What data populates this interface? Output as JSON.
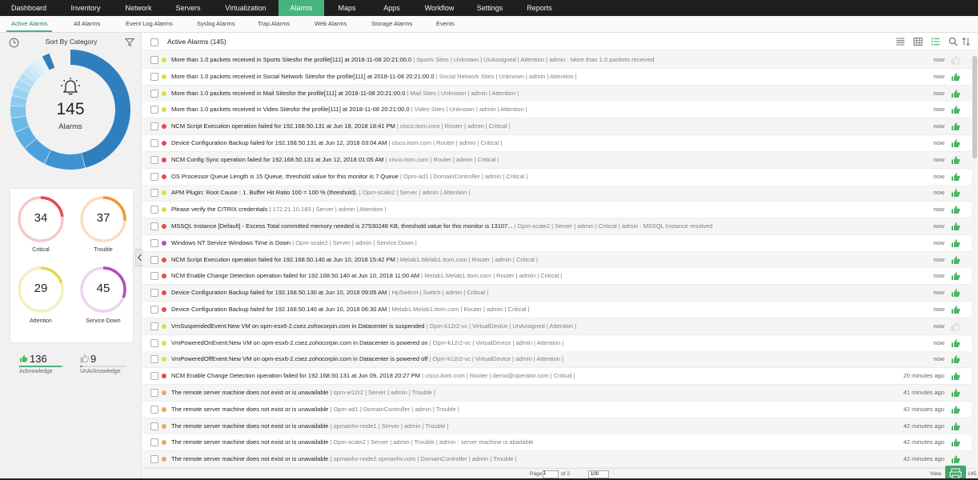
{
  "nav": {
    "items": [
      {
        "label": "Dashboard",
        "active": false
      },
      {
        "label": "Inventory",
        "active": false
      },
      {
        "label": "Network",
        "active": false
      },
      {
        "label": "Servers",
        "active": false
      },
      {
        "label": "Virtualization",
        "active": false
      },
      {
        "label": "Alarms",
        "active": true
      },
      {
        "label": "Maps",
        "active": false
      },
      {
        "label": "Apps",
        "active": false
      },
      {
        "label": "Workflow",
        "active": false
      },
      {
        "label": "Settings",
        "active": false
      },
      {
        "label": "Reports",
        "active": false
      }
    ]
  },
  "subnav": {
    "items": [
      {
        "label": "Active Alarms",
        "active": true
      },
      {
        "label": "All Alarms",
        "active": false
      },
      {
        "label": "Event Log Alarms",
        "active": false
      },
      {
        "label": "Syslog Alarms",
        "active": false
      },
      {
        "label": "Trap Alarms",
        "active": false
      },
      {
        "label": "Web Alarms",
        "active": false
      },
      {
        "label": "Storage Alarms",
        "active": false
      },
      {
        "label": "Events",
        "active": false
      }
    ]
  },
  "sidebar": {
    "sort_title": "Sort By Category",
    "donut": {
      "count": "145",
      "label": "Alarms"
    },
    "severity": [
      {
        "count": "34",
        "label": "Critical",
        "color": "#e8474f",
        "track": "#f6c7c9",
        "fraction": 0.23
      },
      {
        "count": "37",
        "label": "Trouble",
        "color": "#f29734",
        "track": "#fbdcc0",
        "fraction": 0.26
      },
      {
        "count": "29",
        "label": "Attention",
        "color": "#e3d94a",
        "track": "#f4efbf",
        "fraction": 0.2
      },
      {
        "count": "45",
        "label": "Service Down",
        "color": "#b04fb8",
        "track": "#ecd3ee",
        "fraction": 0.31
      }
    ],
    "acknowledge": {
      "count": "136",
      "label": "Acknowledge",
      "fraction": 0.94
    },
    "unacknowledge": {
      "count": "9",
      "label": "UnAcknowledge",
      "fraction": 0.06
    }
  },
  "list": {
    "title": "Active Alarms (145)",
    "rows": [
      {
        "severity": "attention",
        "main": "More than 1.0 packets received in Sports Sitesfor the profile[111] at 2018-11-08 20:21:00.0",
        "meta": " | Sports Sites | Unknown | UnAssigned | Attention | admin : More than 1.0 packets received",
        "time": "now",
        "acknowledged": false
      },
      {
        "severity": "attention",
        "main": "More than 1.0 packets received in Social Network Sitesfor the profile[111] at 2018-11-08 20:21:00.0",
        "meta": " | Social Network Sites | Unknown | admin | Attention |",
        "time": "now",
        "acknowledged": true
      },
      {
        "severity": "attention",
        "main": "More than 1.0 packets received in Mail Sitesfor the profile[111] at 2018-11-08 20:21:00.0",
        "meta": " | Mail Sites | Unknown | admin | Attention |",
        "time": "now",
        "acknowledged": true
      },
      {
        "severity": "attention",
        "main": "More than 1.0 packets received in Video Sitesfor the profile[111] at 2018-11-08 20:21:00.0",
        "meta": " | Video Sites | Unknown | admin | Attention |",
        "time": "now",
        "acknowledged": true
      },
      {
        "severity": "critical",
        "main": "NCM Script Execution operation failed for 192.168.50.131 at Jun 18, 2018 18:41 PM",
        "meta": " | cisco.itom.com | Router | admin | Critical |",
        "time": "now",
        "acknowledged": true
      },
      {
        "severity": "critical",
        "main": "Device Configuration Backup failed for 192.168.50.131 at Jun 12, 2018 03:04 AM",
        "meta": " | cisco.itom.com | Router | admin | Critical |",
        "time": "now",
        "acknowledged": true
      },
      {
        "severity": "critical",
        "main": "NCM Config Sync operation failed for 192.168.50.131 at Jun 12, 2018 01:05 AM",
        "meta": " | cisco.itom.com | Router | admin | Critical |",
        "time": "now",
        "acknowledged": true
      },
      {
        "severity": "critical",
        "main": "OS Processor Queue Length is 15 Queue, threshold value for this monitor is 7 Queue",
        "meta": " | Opm-ad1 | DomainController | admin | Critical |",
        "time": "now",
        "acknowledged": true
      },
      {
        "severity": "attention",
        "main": "APM Plugin: Root Cause : 1. Buffer Hit Ratio 100 = 100 % (threshold).",
        "meta": " | Opm-scale2 | Server | admin | Attention |",
        "time": "now",
        "acknowledged": true
      },
      {
        "severity": "attention",
        "main": "Please verify the CITRIX credentials",
        "meta": " | 172.21.10.183 | Server | admin | Attention |",
        "time": "now",
        "acknowledged": true
      },
      {
        "severity": "critical",
        "main": "MSSQL Instance [Default] - Excess Total committed memory needed is 27530248 KB, threshold value for this monitor is 13107...",
        "meta": " | Opm-scale2 | Server | admin | Critical | admin : MSSQL Instance resolved",
        "time": "now",
        "acknowledged": true
      },
      {
        "severity": "servicedown",
        "main": "Windows NT Service Windows Time is Down",
        "meta": " | Opm-scale2 | Server | admin | Service Down |",
        "time": "now",
        "acknowledged": true
      },
      {
        "severity": "critical",
        "main": "NCM Script Execution operation failed for 192.168.50.140 at Jun 10, 2018 15:42 PM",
        "meta": " | Melab1.Melab1.itom.com | Router | admin | Critical |",
        "time": "now",
        "acknowledged": true
      },
      {
        "severity": "critical",
        "main": "NCM Enable Change Detection operation failed for 192.168.50.140 at Jun 10, 2018 11:00 AM",
        "meta": " | Melab1.Melab1.itom.com | Router | admin | Critical |",
        "time": "now",
        "acknowledged": true
      },
      {
        "severity": "critical",
        "main": "Device Configuration Backup failed for 192.168.50.130 at Jun 10, 2018 09:05 AM",
        "meta": " | HpSwitcH | Switch | admin | Critical |",
        "time": "now",
        "acknowledged": true
      },
      {
        "severity": "critical",
        "main": "Device Configuration Backup failed for 192.168.50.140 at Jun 10, 2018 06:30 AM",
        "meta": " | Melab1.Melab1.itom.com | Router | admin | Critical |",
        "time": "now",
        "acknowledged": true
      },
      {
        "severity": "attention",
        "main": "VmSuspendedEvent:New VM on opm-esx6-2.csez.zohocorpin.com in Datacenter is suspended",
        "meta": " | Opm-k12r2-vc | VirtualDevice | UnAssigned | Attention |",
        "time": "now",
        "acknowledged": false
      },
      {
        "severity": "attention",
        "main": "VmPoweredOnEvent:New VM on opm-esx6-2.csez.zohocorpin.com in Datacenter is powered on",
        "meta": " | Opm-k12r2-vc | VirtualDevice | admin | Attention |",
        "time": "now",
        "acknowledged": true
      },
      {
        "severity": "attention",
        "main": "VmPoweredOffEvent:New VM on opm-esx6-2.csez.zohocorpin.com in Datacenter is powered off",
        "meta": " | Opm-k12r2-vc | VirtualDevice | admin | Attention |",
        "time": "now",
        "acknowledged": true
      },
      {
        "severity": "critical",
        "main": "NCM Enable Change Detection operation failed for 192.168.50.131 at Jun 09, 2018 20:27 PM",
        "meta": " | cisco.itom.com | Router | demo@operator.com | Critical |",
        "time": "20 minutes ago",
        "acknowledged": true
      },
      {
        "severity": "trouble",
        "main": "The remote server machine does not exist or is unavailable",
        "meta": " | opm-w12r2 | Server | admin | Trouble |",
        "time": "41 minutes ago",
        "acknowledged": true
      },
      {
        "severity": "trouble",
        "main": "The remote server machine does not exist or is unavailable",
        "meta": " | Opm-ad1 | DomainController | admin | Trouble |",
        "time": "42 minutes ago",
        "acknowledged": true
      },
      {
        "severity": "trouble",
        "main": "The remote server machine does not exist or is unavailable",
        "meta": " | opmanhv-node1 | Server | admin | Trouble |",
        "time": "42 minutes ago",
        "acknowledged": true
      },
      {
        "severity": "trouble",
        "main": "The remote server machine does not exist or is unavailable",
        "meta": " | Opm-scale2 | Server | admin | Trouble | admin : server machine is abailable",
        "time": "42 minutes ago",
        "acknowledged": true
      },
      {
        "severity": "trouble",
        "main": "The remote server machine does not exist or is unavailable",
        "meta": " | opmanhv-node2.opmanhv.com | DomainController | admin | Trouble |",
        "time": "42 minutes ago",
        "acknowledged": true
      }
    ]
  },
  "footer": {
    "page_label": "Page",
    "page_value": "1",
    "of_pages": "of 2",
    "page_size": "100",
    "view_label": "View",
    "total": "145"
  },
  "colors": {
    "accent": "#47b47d",
    "critical": "#e8474f",
    "trouble": "#f2a35a",
    "attention": "#e3d94a",
    "servicedown": "#b04fb8",
    "thumb_ack": "#4fb464",
    "thumb_unack": "#d0d0d0"
  }
}
